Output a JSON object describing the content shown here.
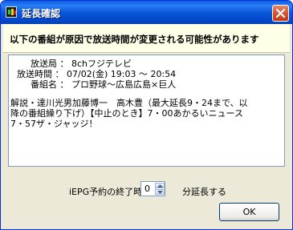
{
  "window": {
    "title": "延長確認",
    "accent": "#0654d8",
    "close_color": "#d8502c"
  },
  "header": {
    "message": "以下の番組が原因で放送時間が変更される可能性があります"
  },
  "program_info": {
    "line1": "　放送局 ： 8chフジテレビ",
    "line2": "放送時間 ： 07/02(金) 19:03 ～ 20:54",
    "line3": "　番組名 ： プロ野球～広島広島×巨人",
    "desc1": "解説・達川光男加藤博一　高木豊（最大延長9・24まで、以",
    "desc2": "降の番組繰り下げ）【中止のとき】7・00あかるいニュース",
    "desc3": "7・57ザ・ジャッジ！"
  },
  "extension": {
    "label_before": "iEPG予約の終了時間を",
    "spin_value": "0",
    "label_after": "分延長する"
  },
  "buttons": {
    "ok_label": "OK"
  },
  "icons": {
    "app": "app-icon",
    "close": "close-icon",
    "spin_up": "spin-up-icon",
    "spin_down": "spin-down-icon"
  }
}
